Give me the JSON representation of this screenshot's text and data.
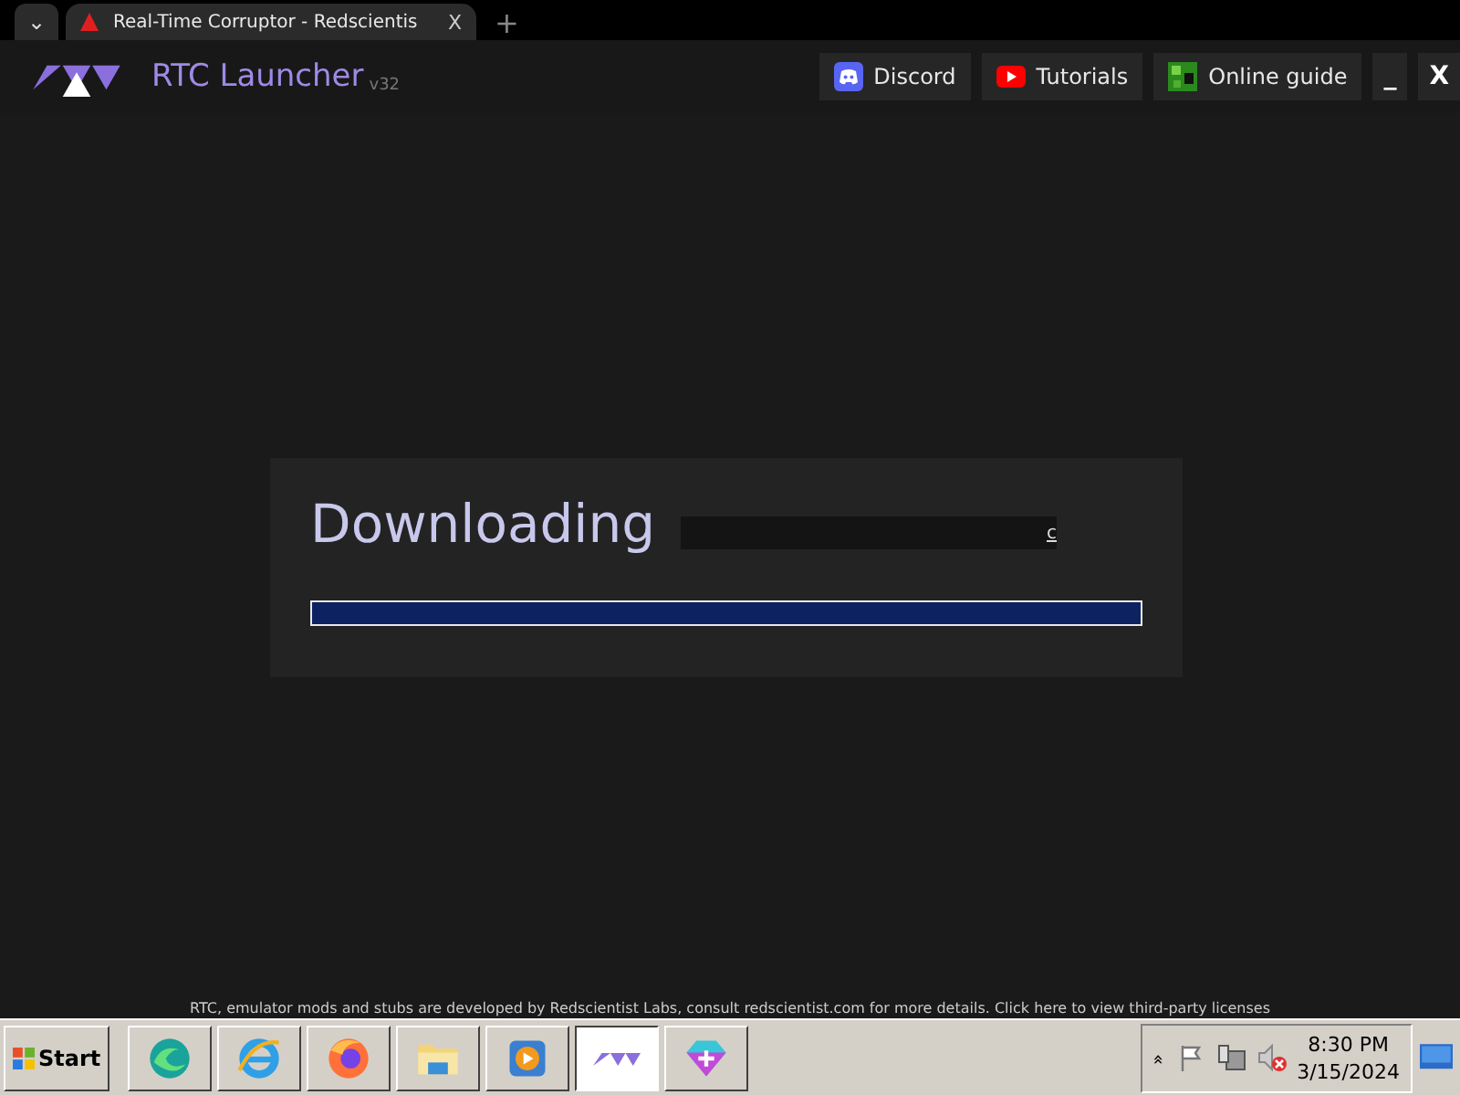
{
  "browser": {
    "tab_title": "Real-Time Corruptor - Redscientis",
    "dropdown": "⌄",
    "close": "X",
    "new_tab": "+"
  },
  "app": {
    "title": "RTC Launcher",
    "version": "v32",
    "header_buttons": [
      {
        "kind": "discord",
        "label": "Discord"
      },
      {
        "kind": "youtube",
        "label": "Tutorials"
      },
      {
        "kind": "guide",
        "label": "Online guide"
      }
    ],
    "minimize": "_",
    "close": "X"
  },
  "download": {
    "title": "Downloading",
    "status": "c",
    "level": 1.0
  },
  "footer": "RTC, emulator mods and stubs are developed by Redscientist Labs, consult redscientist.com for more details. Click here to view third-party licenses",
  "taskbar": {
    "start": "Start",
    "apps": [
      {
        "kind": "edge",
        "selected": false
      },
      {
        "kind": "ie",
        "selected": false
      },
      {
        "kind": "firefox",
        "selected": false
      },
      {
        "kind": "folder",
        "selected": false
      },
      {
        "kind": "media",
        "selected": false
      },
      {
        "kind": "rtc",
        "selected": true
      },
      {
        "kind": "gem",
        "selected": false
      }
    ],
    "tray_expand": "»",
    "time": "8:30 PM",
    "date": "3/15/2024"
  }
}
